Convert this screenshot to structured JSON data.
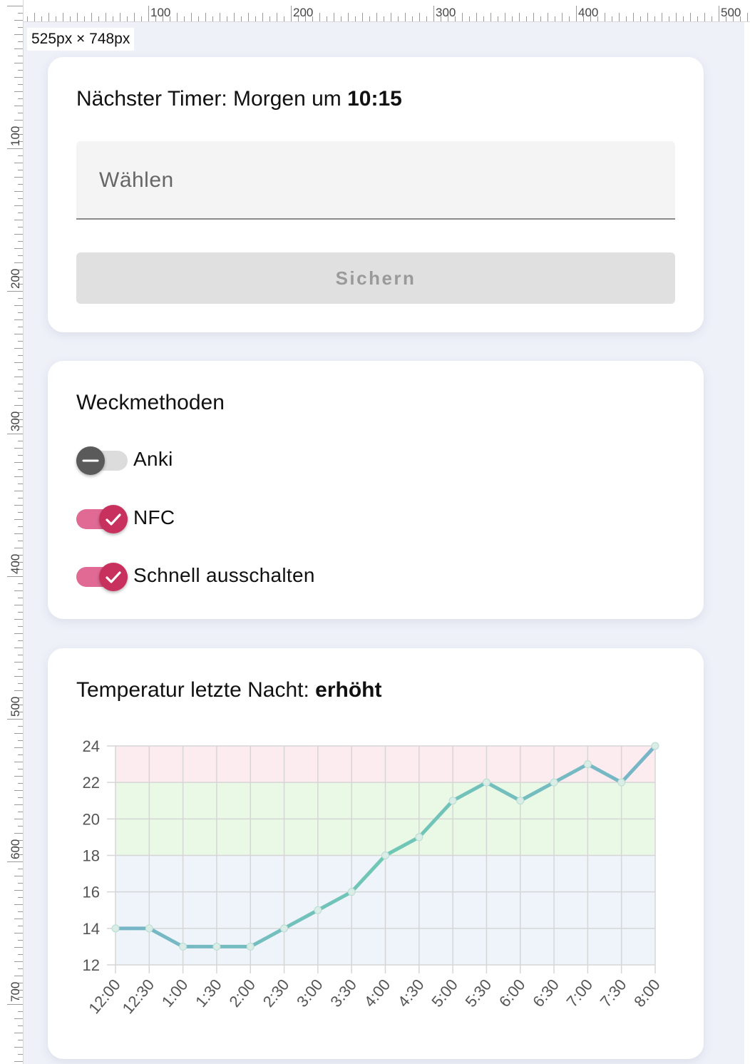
{
  "ruler": {
    "top_labels": [
      "100",
      "200",
      "300",
      "400",
      "500"
    ],
    "left_labels": [
      "100",
      "200",
      "300",
      "400",
      "500",
      "600",
      "700"
    ]
  },
  "viewport_size": "525px × 748px",
  "timer_card": {
    "title_prefix": "Nächster Timer: Morgen um ",
    "title_time": "10:15",
    "select_placeholder": "Wählen",
    "save_label": "Sichern"
  },
  "methods_card": {
    "title": "Weckmethoden",
    "toggles": [
      {
        "label": "Anki",
        "checked": false
      },
      {
        "label": "NFC",
        "checked": true
      },
      {
        "label": "Schnell ausschalten",
        "checked": true
      }
    ]
  },
  "temp_card": {
    "title_prefix": "Temperatur letzte Nacht: ",
    "title_status": "erhöht"
  },
  "colors": {
    "accent": "#c8315e",
    "track_on": "#e06a93",
    "line_start": "#6fc8b4",
    "line_end": "#78b4c8",
    "band_high": "#fcecf0",
    "band_ok": "#eaf8e6",
    "band_low": "#eef4fa"
  },
  "chart_data": {
    "type": "line",
    "categories": [
      "12:00",
      "12:30",
      "1:00",
      "1:30",
      "2:00",
      "2:30",
      "3:00",
      "3:30",
      "4:00",
      "4:30",
      "5:00",
      "5:30",
      "6:00",
      "6:30",
      "7:00",
      "7:30",
      "8:00"
    ],
    "values": [
      14,
      14,
      13,
      13,
      13,
      14,
      15,
      16,
      18,
      19,
      21,
      22,
      21,
      22,
      23,
      22,
      24
    ],
    "ylim": [
      12,
      24
    ],
    "yticks": [
      12,
      14,
      16,
      18,
      20,
      22,
      24
    ],
    "bands": [
      {
        "from": 12,
        "to": 18,
        "color": "#eef4fa"
      },
      {
        "from": 18,
        "to": 22,
        "color": "#eaf8e6"
      },
      {
        "from": 22,
        "to": 24,
        "color": "#fcecf0"
      }
    ],
    "grid": true,
    "legend": "none"
  }
}
